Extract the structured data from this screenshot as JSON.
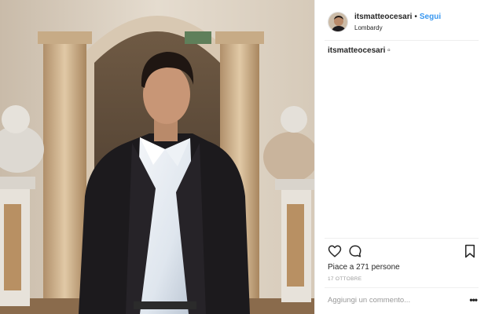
{
  "post": {
    "username": "itsmatteocesari",
    "separator": "•",
    "follow_label": "Segui",
    "location": "Lombardy",
    "caption_user": "itsmatteocesari",
    "caption_emoji": "▫",
    "likes_text": "Piace a 271 persone",
    "date": "17 OTTOBRE",
    "comment_placeholder": "Aggiungi un commento...",
    "more_label": "•••"
  },
  "icons": {
    "like": "heart-icon",
    "comment": "comment-bubble-icon",
    "save": "bookmark-icon"
  },
  "colors": {
    "accent": "#3897f0",
    "text": "#262626",
    "muted": "#999999",
    "divider": "#efefef"
  }
}
